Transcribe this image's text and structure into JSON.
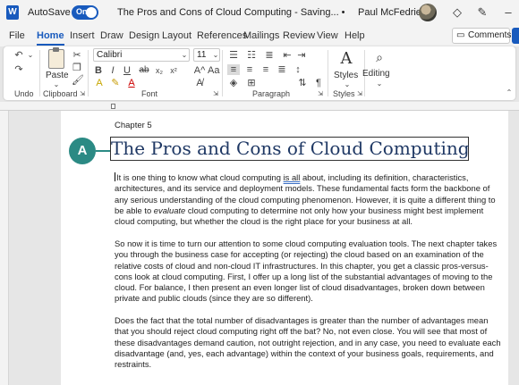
{
  "titlebar": {
    "app_icon_letter": "W",
    "autosave_label": "AutoSave",
    "autosave_state": "On",
    "doc_title": "The Pros and Cons of Cloud Computing  -  Saving...  •",
    "user_name": "Paul McFedries"
  },
  "tabs": [
    "File",
    "Home",
    "Insert",
    "Draw",
    "Design",
    "Layout",
    "References",
    "Mailings",
    "Review",
    "View",
    "Help"
  ],
  "active_tab": "Home",
  "comments_label": "Comments",
  "ribbon": {
    "undo_label": "Undo",
    "clipboard_label": "Clipboard",
    "paste_label": "Paste",
    "font_name": "Calibri",
    "font_size": "11",
    "font_label": "Font",
    "paragraph_label": "Paragraph",
    "styles_button": "Styles",
    "styles_label": "Styles",
    "editing_button": "Editing"
  },
  "document": {
    "chapter": "Chapter 5",
    "heading": "The Pros and Cons of Cloud Computing",
    "callout": "A",
    "paragraphs": [
      [
        "It is one thing to know what cloud computing is all about, including its definition, characteristics,",
        "architectures, and its service and deployment models. These fundamental facts form the backbone of",
        "any serious understanding of the cloud computing phenomenon. However, it is quite a different thing to",
        "be able to evaluate cloud computing to determine not only how your business might best implement",
        "cloud computing, but whether the cloud is the right place for your business at all."
      ],
      [
        "So now it is time to turn our attention to some cloud computing evaluation tools. The next chapter takes",
        "you through the business case for accepting (or rejecting) the cloud based on an examination of the",
        "relative costs of cloud and non-cloud IT infrastructures. In this chapter, you get a classic pros-versus-",
        "cons look at cloud computing. First, I offer up a long list of the substantial advantages of moving to the",
        "cloud. For balance, I then present an even longer list of cloud disadvantages, broken down between",
        "private and public clouds (since they are so different)."
      ],
      [
        "Does the fact that the total number of disadvantages is greater than the number of advantages mean",
        "that you should reject cloud computing right off the bat? No, not even close. You will see that most of",
        "these disadvantages demand caution, not outright rejection, and in any case, you need to evaluate each",
        "disadvantage (and, yes, each advantage) within the context of your business goals, requirements, and",
        "restraints."
      ]
    ]
  },
  "colors": {
    "accent": "#185abd",
    "heading": "#1f3864",
    "callout": "#2b8a84"
  }
}
